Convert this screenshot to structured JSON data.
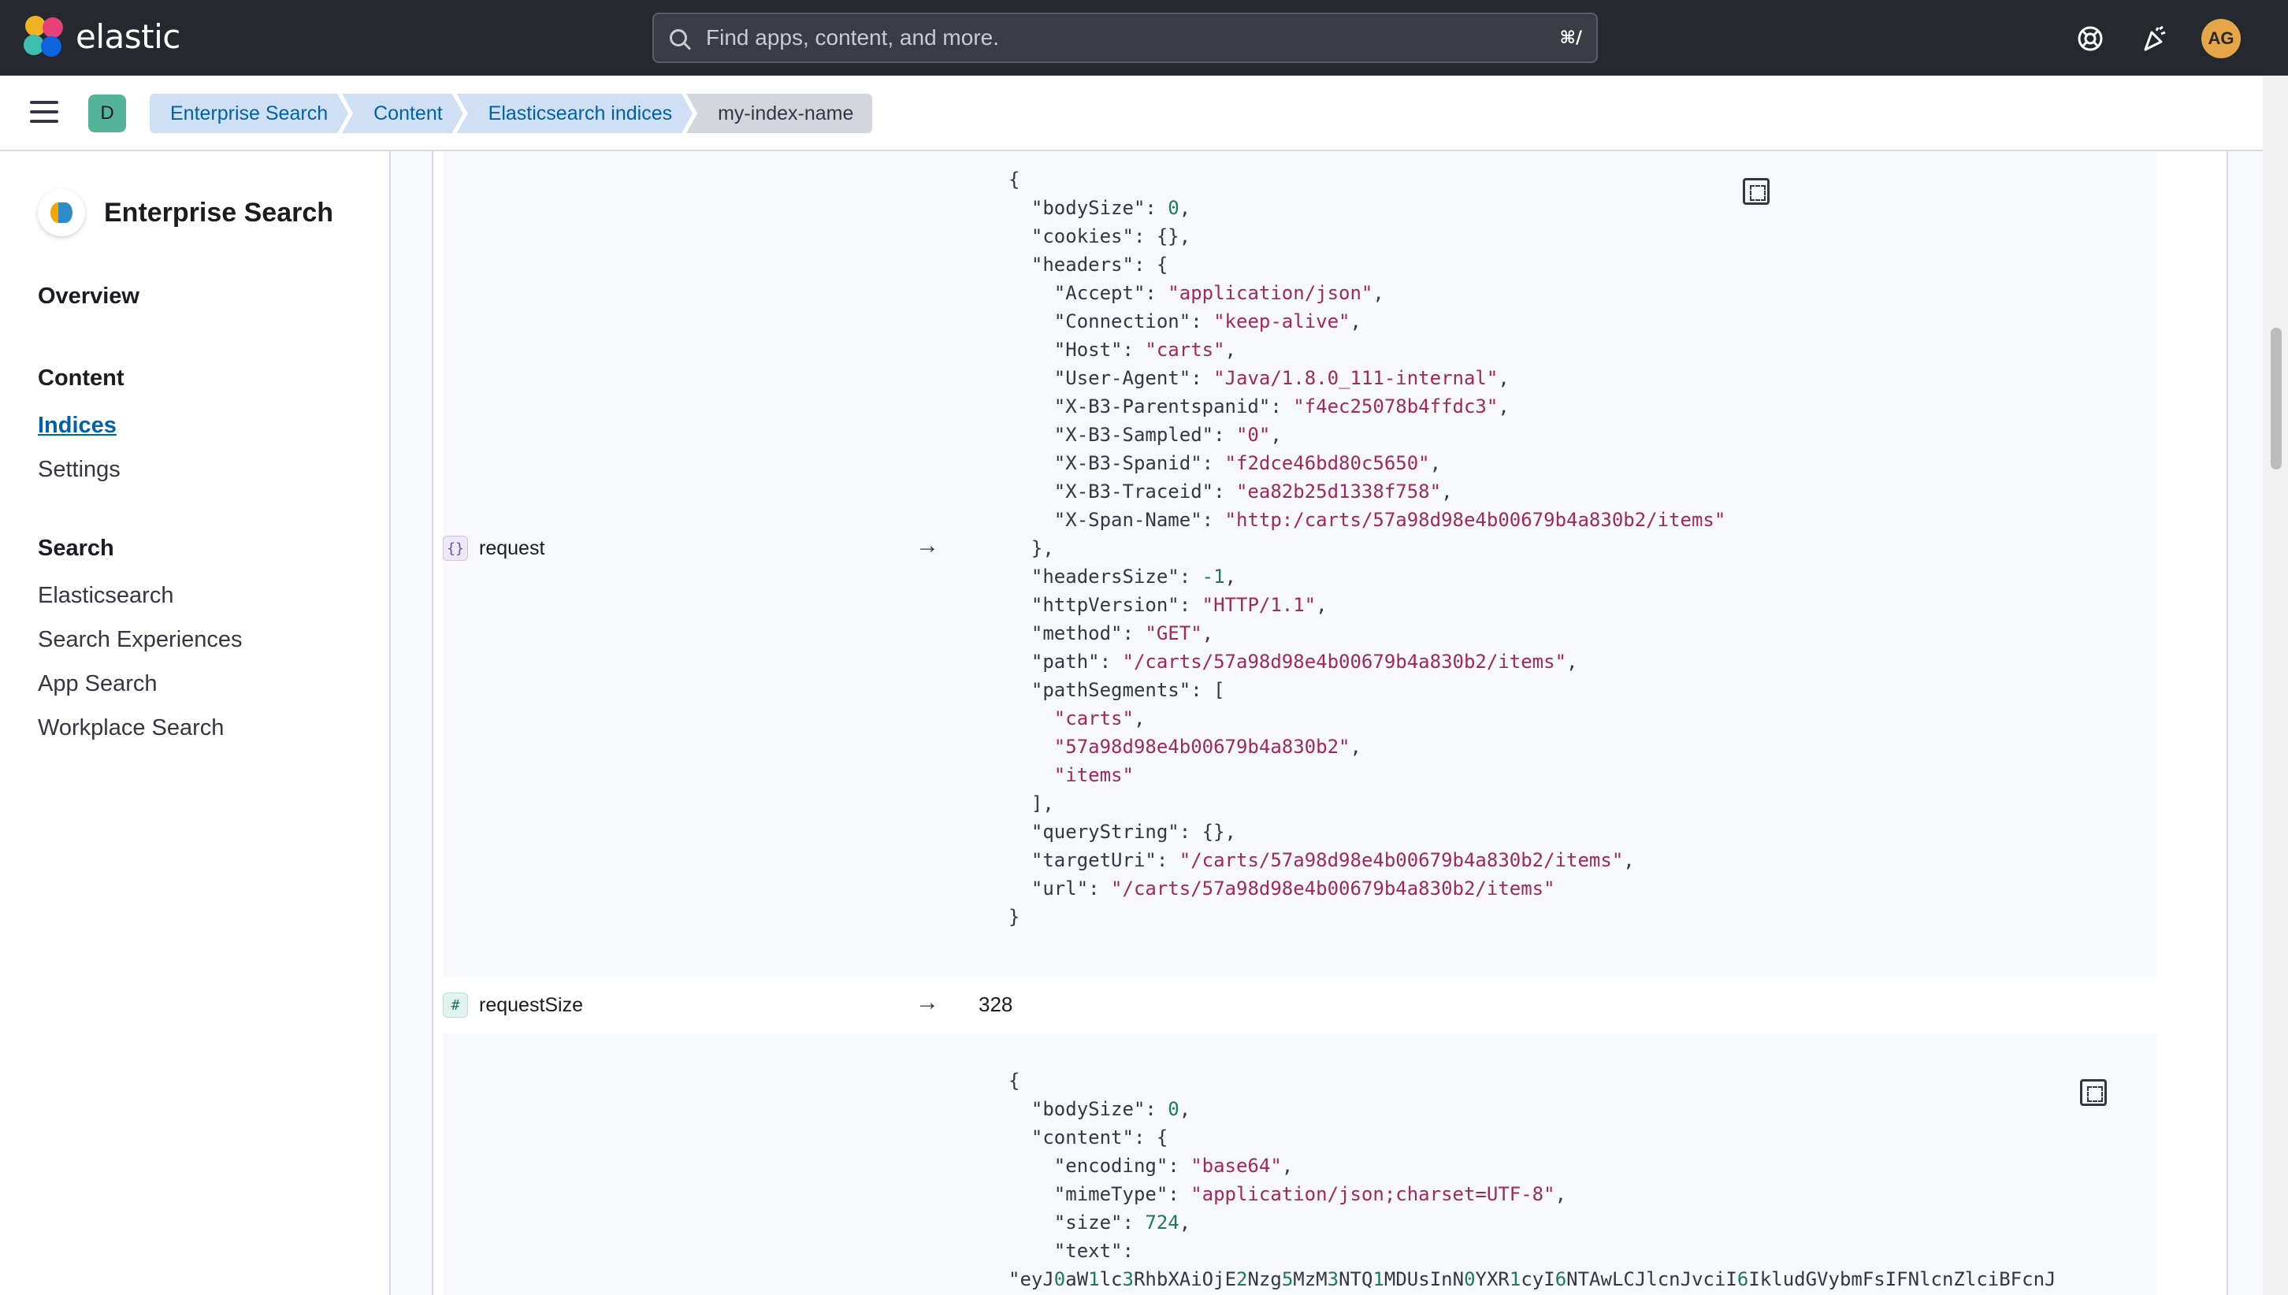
{
  "app": {
    "brand": "elastic",
    "search_placeholder": "Find apps, content, and more.",
    "search_shortcut": "⌘/",
    "user_initials": "AG",
    "space_initial": "D"
  },
  "breadcrumbs": [
    "Enterprise Search",
    "Content",
    "Elasticsearch indices",
    "my-index-name"
  ],
  "sidebar": {
    "title": "Enterprise Search",
    "overview": "Overview",
    "content_section": "Content",
    "content_items": [
      "Indices",
      "Settings"
    ],
    "search_section": "Search",
    "search_items": [
      "Elasticsearch",
      "Search Experiences",
      "App Search",
      "Workplace Search"
    ]
  },
  "fields": {
    "request": {
      "name": "request",
      "type_icon": "{}",
      "json_lines": [
        "{",
        "  \"bodySize\": 0,",
        "  \"cookies\": {},",
        "  \"headers\": {",
        "    \"Accept\": \"application/json\",",
        "    \"Connection\": \"keep-alive\",",
        "    \"Host\": \"carts\",",
        "    \"User-Agent\": \"Java/1.8.0_111-internal\",",
        "    \"X-B3-Parentspanid\": \"f4ec25078b4ffdc3\",",
        "    \"X-B3-Sampled\": \"0\",",
        "    \"X-B3-Spanid\": \"f2dce46bd80c5650\",",
        "    \"X-B3-Traceid\": \"ea82b25d1338f758\",",
        "    \"X-Span-Name\": \"http:/carts/57a98d98e4b00679b4a830b2/items\"",
        "  },",
        "  \"headersSize\": -1,",
        "  \"httpVersion\": \"HTTP/1.1\",",
        "  \"method\": \"GET\",",
        "  \"path\": \"/carts/57a98d98e4b00679b4a830b2/items\",",
        "  \"pathSegments\": [",
        "    \"carts\",",
        "    \"57a98d98e4b00679b4a830b2\",",
        "    \"items\"",
        "  ],",
        "  \"queryString\": {},",
        "  \"targetUri\": \"/carts/57a98d98e4b00679b4a830b2/items\",",
        "  \"url\": \"/carts/57a98d98e4b00679b4a830b2/items\"",
        "}"
      ]
    },
    "requestSize": {
      "name": "requestSize",
      "type_icon": "#",
      "value": "328"
    },
    "response": {
      "json_lines": [
        "{",
        "  \"bodySize\": 0,",
        "  \"content\": {",
        "    \"encoding\": \"base64\",",
        "    \"mimeType\": \"application/json;charset=UTF-8\",",
        "    \"size\": 724,",
        "    \"text\":",
        "\"eyJ0aW1lc3RhbXAiOjE2Nzg5MzM3NTQ1MDUsInN0YXR1cyI6NTAwLCJlcnJvciI6IkludGVybmFsIFNlcnZlciBFcnJ"
      ]
    }
  },
  "colors": {
    "header_bg": "#25282f",
    "link": "#0061a6",
    "string": "#a02958",
    "number": "#1b7a5a"
  }
}
